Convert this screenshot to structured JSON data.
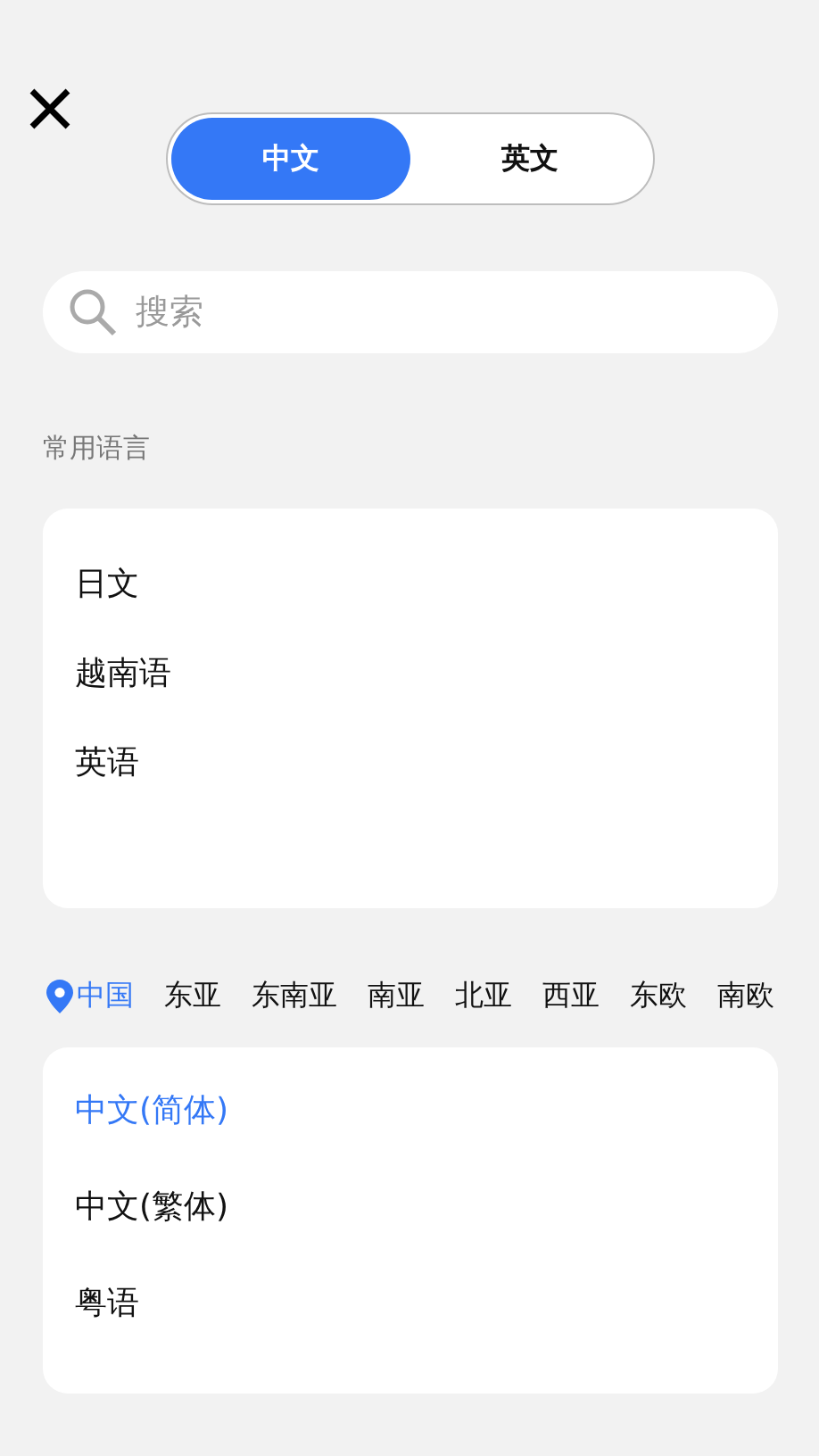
{
  "toggle": [
    {
      "label": "中文",
      "selected": true
    },
    {
      "label": "英文",
      "selected": false
    }
  ],
  "search": {
    "placeholder": "搜索"
  },
  "common": {
    "title": "常用语言",
    "items": [
      "日文",
      "越南语",
      "英语"
    ]
  },
  "regions": [
    {
      "label": "中国",
      "selected": true
    },
    {
      "label": "东亚",
      "selected": false
    },
    {
      "label": "东南亚",
      "selected": false
    },
    {
      "label": "南亚",
      "selected": false
    },
    {
      "label": "北亚",
      "selected": false
    },
    {
      "label": "西亚",
      "selected": false
    },
    {
      "label": "东欧",
      "selected": false
    },
    {
      "label": "南欧",
      "selected": false
    }
  ],
  "languages": [
    {
      "label": "中文(简体)",
      "selected": true
    },
    {
      "label": "中文(繁体)",
      "selected": false
    },
    {
      "label": "粤语",
      "selected": false
    }
  ]
}
